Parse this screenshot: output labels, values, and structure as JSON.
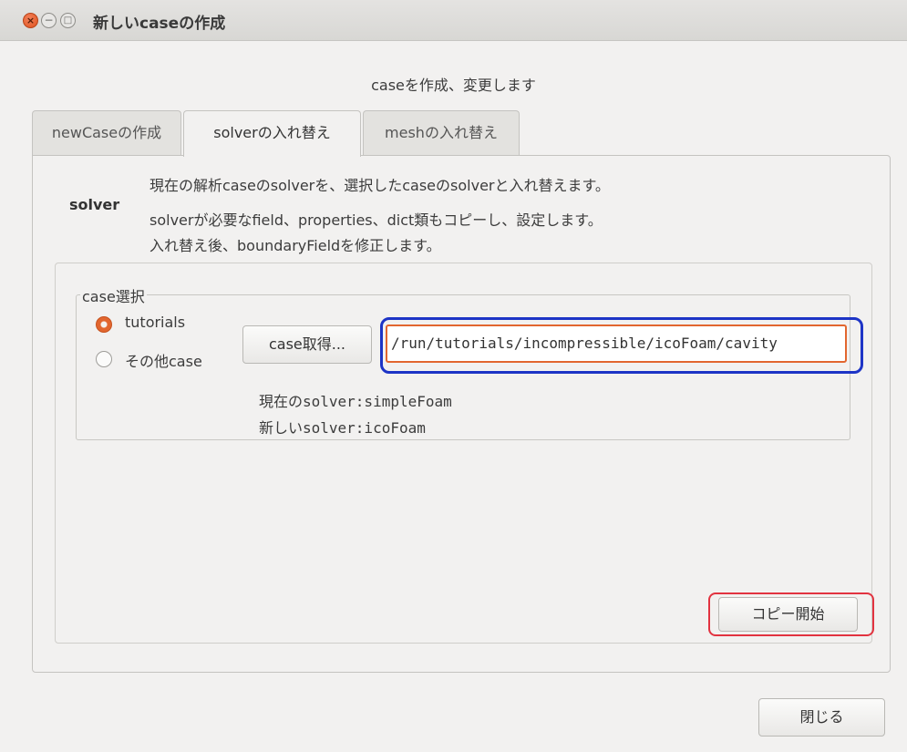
{
  "window": {
    "title": "新しいcaseの作成",
    "controls": {
      "close": "×",
      "minimize": "−",
      "maximize": "□"
    }
  },
  "subtitle": "caseを作成、変更します",
  "tabs": [
    {
      "label": "newCaseの作成",
      "active": false
    },
    {
      "label": "solverの入れ替え",
      "active": true
    },
    {
      "label": "meshの入れ替え",
      "active": false
    }
  ],
  "solver_section": {
    "label": "solver",
    "description": [
      "現在の解析caseのsolverを、選択したcaseのsolverと入れ替えます。",
      "solverが必要なfield、properties、dict類もコピーし、設定します。",
      "入れ替え後、boundaryFieldを修正します。"
    ]
  },
  "case_select": {
    "group_label": "case選択",
    "options": [
      {
        "label": "tutorials",
        "selected": true
      },
      {
        "label": "その他case",
        "selected": false
      }
    ],
    "get_case_button": "case取得...",
    "path_value": "/run/tutorials/incompressible/icoFoam/cavity",
    "current_solver": "現在のsolver:simpleFoam",
    "new_solver": "新しいsolver:icoFoam"
  },
  "copy_button": "コピー開始",
  "close_button": "閉じる",
  "colors": {
    "accent": "#e2662f",
    "highlight_blue": "#1d34c6",
    "highlight_red": "#e23340",
    "background": "#f2f1f0"
  }
}
